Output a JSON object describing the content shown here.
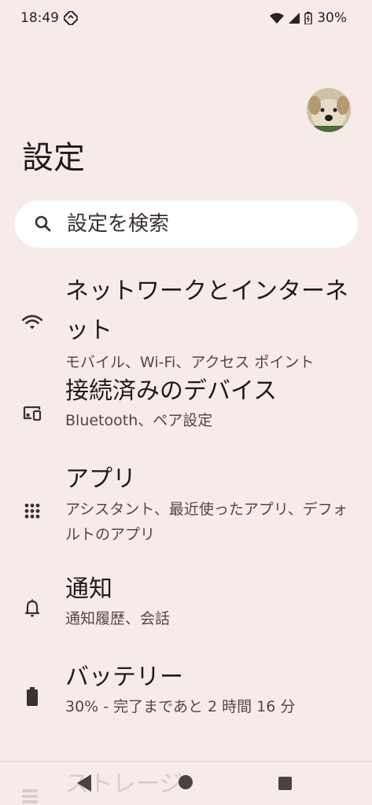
{
  "status_bar": {
    "time": "18:49",
    "battery": "30%"
  },
  "header": {
    "title": "設定"
  },
  "search": {
    "placeholder": "設定を検索"
  },
  "items": [
    {
      "title": "ネットワークとインターネット",
      "summary": "モバイル、Wi-Fi、アクセス ポイント",
      "icon": "wifi-icon"
    },
    {
      "title": "接続済みのデバイス",
      "summary": "Bluetooth、ペア設定",
      "icon": "devices-icon"
    },
    {
      "title": "アプリ",
      "summary": "アシスタント、最近使ったアプリ、デフォルトのアプリ",
      "icon": "apps-grid-icon"
    },
    {
      "title": "通知",
      "summary": "通知履歴、会話",
      "icon": "bell-icon"
    },
    {
      "title": "バッテリー",
      "summary": "30% - 完了まであと 2 時間 16 分",
      "icon": "battery-icon"
    },
    {
      "title": "ストレージ",
      "summary": "",
      "icon": "storage-icon"
    }
  ],
  "colors": {
    "background": "#f7ebe9",
    "text": "#221a19",
    "search_bg": "#ffffff"
  }
}
